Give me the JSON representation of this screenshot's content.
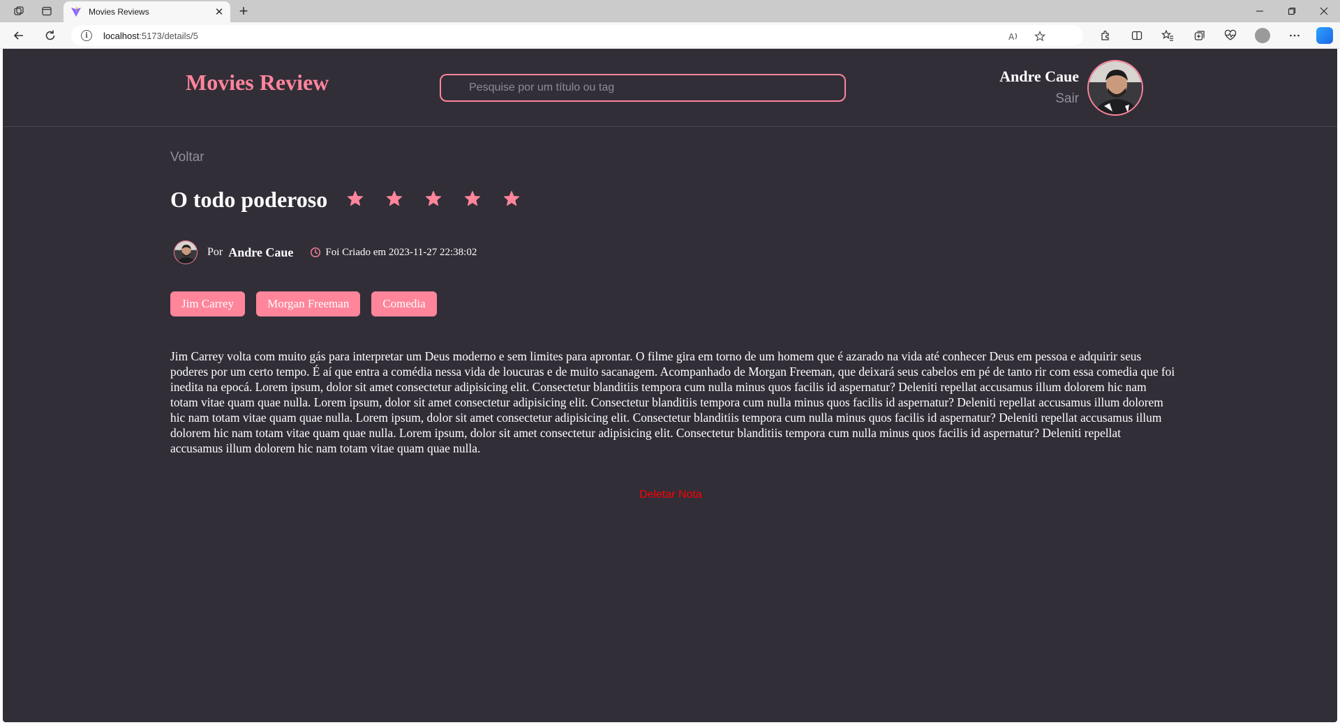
{
  "browser": {
    "tab_title": "Movies Reviews",
    "url_host": "localhost",
    "url_path": ":5173/details/5"
  },
  "header": {
    "brand": "Movies Review",
    "search_placeholder": "Pesquise por um título ou tag",
    "user_name": "Andre Caue",
    "logout_label": "Sair"
  },
  "note": {
    "back_label": "Voltar",
    "title": "O todo poderoso",
    "rating": 5,
    "rating_max": 5,
    "by_label": "Por",
    "author": "Andre Caue",
    "created_at": "Foi Criado em 2023-11-27 22:38:02",
    "tags": [
      "Jim Carrey",
      "Morgan Freeman",
      "Comedia"
    ],
    "description": "Jim Carrey volta com muito gás para interpretar um Deus moderno e sem limites para aprontar. O filme gira em torno de um homem que é azarado na vida até conhecer Deus em pessoa e adquirir seus poderes por um certo tempo. É aí que entra a comédia nessa vida de loucuras e de muito sacanagem. Acompanhado de Morgan Freeman, que deixará seus cabelos em pé de tanto rir com essa comedia que foi inedita na epocá. Lorem ipsum, dolor sit amet consectetur adipisicing elit. Consectetur blanditiis tempora cum nulla minus quos facilis id aspernatur? Deleniti repellat accusamus illum dolorem hic nam totam vitae quam quae nulla. Lorem ipsum, dolor sit amet consectetur adipisicing elit. Consectetur blanditiis tempora cum nulla minus quos facilis id aspernatur? Deleniti repellat accusamus illum dolorem hic nam totam vitae quam quae nulla. Lorem ipsum, dolor sit amet consectetur adipisicing elit. Consectetur blanditiis tempora cum nulla minus quos facilis id aspernatur? Deleniti repellat accusamus illum dolorem hic nam totam vitae quam quae nulla. Lorem ipsum, dolor sit amet consectetur adipisicing elit. Consectetur blanditiis tempora cum nulla minus quos facilis id aspernatur? Deleniti repellat accusamus illum dolorem hic nam totam vitae quam quae nulla.",
    "delete_label": "Deletar Nota"
  },
  "colors": {
    "background": "#312e38",
    "accent": "#ff859b",
    "muted_text": "#948f99",
    "danger": "#ff0000"
  },
  "icons": {
    "browser": [
      "workspaces-icon",
      "tab-actions-icon",
      "back-icon",
      "refresh-icon",
      "info-icon",
      "read-aloud-icon",
      "favorite-icon",
      "extensions-icon",
      "split-screen-icon",
      "favorites-icon",
      "collections-icon",
      "browser-essentials-icon",
      "profile-icon",
      "more-icon",
      "copilot-icon"
    ],
    "page": [
      "star-icon",
      "clock-icon"
    ]
  }
}
